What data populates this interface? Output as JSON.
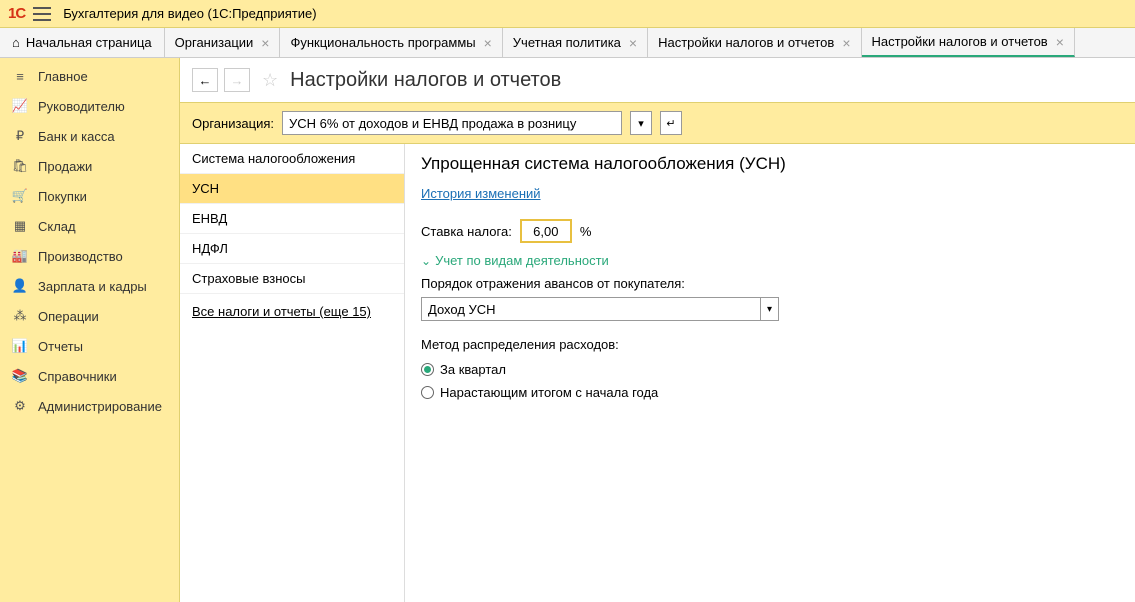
{
  "app_title": "Бухгалтерия для видео  (1С:Предприятие)",
  "home_tab": "Начальная страница",
  "tabs": [
    {
      "label": "Организации"
    },
    {
      "label": "Функциональность программы"
    },
    {
      "label": "Учетная политика"
    },
    {
      "label": "Настройки налогов и отчетов"
    },
    {
      "label": "Настройки налогов и отчетов",
      "active": true
    }
  ],
  "sidebar": [
    {
      "icon": "≡",
      "label": "Главное"
    },
    {
      "icon": "📈",
      "label": "Руководителю"
    },
    {
      "icon": "₽",
      "label": "Банк и касса"
    },
    {
      "icon": "🛍",
      "label": "Продажи"
    },
    {
      "icon": "🛒",
      "label": "Покупки"
    },
    {
      "icon": "▦",
      "label": "Склад"
    },
    {
      "icon": "🏭",
      "label": "Производство"
    },
    {
      "icon": "👤",
      "label": "Зарплата и кадры"
    },
    {
      "icon": "⁂",
      "label": "Операции"
    },
    {
      "icon": "📊",
      "label": "Отчеты"
    },
    {
      "icon": "📚",
      "label": "Справочники"
    },
    {
      "icon": "⚙",
      "label": "Администрирование"
    }
  ],
  "page_title": "Настройки налогов и отчетов",
  "org_label": "Организация:",
  "org_value": "УСН 6% от доходов и ЕНВД продажа в розницу",
  "categories": [
    {
      "label": "Система налогообложения"
    },
    {
      "label": "УСН",
      "selected": true
    },
    {
      "label": "ЕНВД"
    },
    {
      "label": "НДФЛ"
    },
    {
      "label": "Страховые взносы"
    }
  ],
  "all_taxes_link": "Все налоги и отчеты (еще 15)",
  "detail": {
    "heading": "Упрощенная система налогообложения (УСН)",
    "history_link": "История изменений",
    "rate_label": "Ставка налога:",
    "rate_value": "6,00",
    "rate_suffix": "%",
    "activity_section": "Учет по видам деятельности",
    "advance_label": "Порядок отражения авансов от покупателя:",
    "advance_value": "Доход УСН",
    "method_label": "Метод распределения расходов:",
    "radio1": "За квартал",
    "radio2": "Нарастающим итогом с начала года"
  }
}
